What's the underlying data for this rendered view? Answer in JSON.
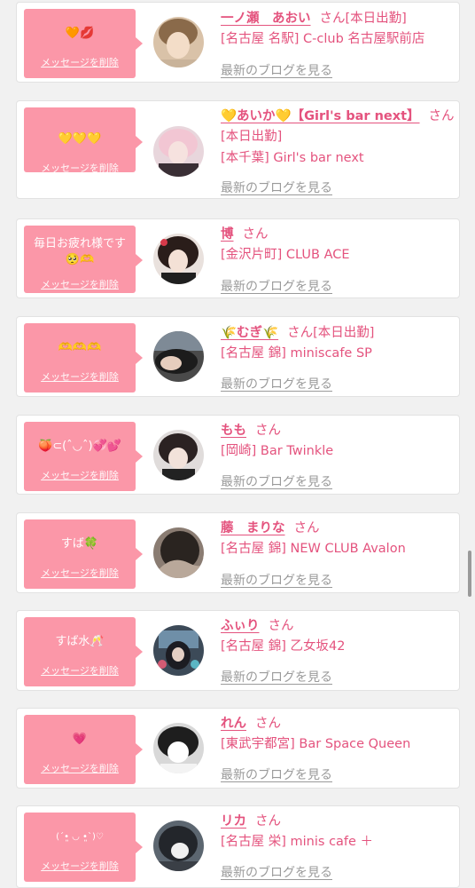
{
  "delete_label": "メッセージを削除",
  "blog_label": "最新のブログを見る",
  "san": "さん",
  "cards": [
    {
      "message": "🧡💋",
      "name": "一ノ瀬　あおい",
      "name_suffix": "[本日出勤]",
      "shops": [
        "[名古屋 名駅] C-club 名古屋駅前店"
      ]
    },
    {
      "message": "💛💛💛",
      "name": "💛あいか💛【Girl's bar next】",
      "name_suffix": "",
      "shops": [
        "[本日出勤]",
        "[本千葉] Girl's bar next"
      ]
    },
    {
      "message": "毎日お疲れ様です🥺🫶",
      "name": "博",
      "name_suffix": "",
      "shops": [
        "[金沢片町] CLUB ACE"
      ]
    },
    {
      "message": "🫶🫶🫶",
      "name": "🌾むぎ🌾",
      "name_suffix": "[本日出勤]",
      "shops": [
        "[名古屋 錦] miniscafe SP"
      ]
    },
    {
      "message": "🍑⊂(ˆ◡ˆ)💞💕",
      "name": "もも",
      "name_suffix": "",
      "shops": [
        "[岡崎] Bar Twinkle"
      ]
    },
    {
      "message": "すば🍀",
      "name": "藤　まりな",
      "name_suffix": "",
      "shops": [
        "[名古屋 錦] NEW CLUB Avalon"
      ]
    },
    {
      "message": "すば水🥂",
      "name": "ふぃり",
      "name_suffix": "",
      "shops": [
        "[名古屋 錦] 乙女坂42"
      ]
    },
    {
      "message": "💗",
      "name": "れん",
      "name_suffix": "",
      "shops": [
        "[東武宇都宮] Bar Space Queen"
      ]
    },
    {
      "message": "(ˊ•͈ ◡ •͈ˋ)♡",
      "name": "リカ",
      "name_suffix": "",
      "shops": [
        "[名古屋 栄] minis cafe ＋"
      ]
    }
  ]
}
